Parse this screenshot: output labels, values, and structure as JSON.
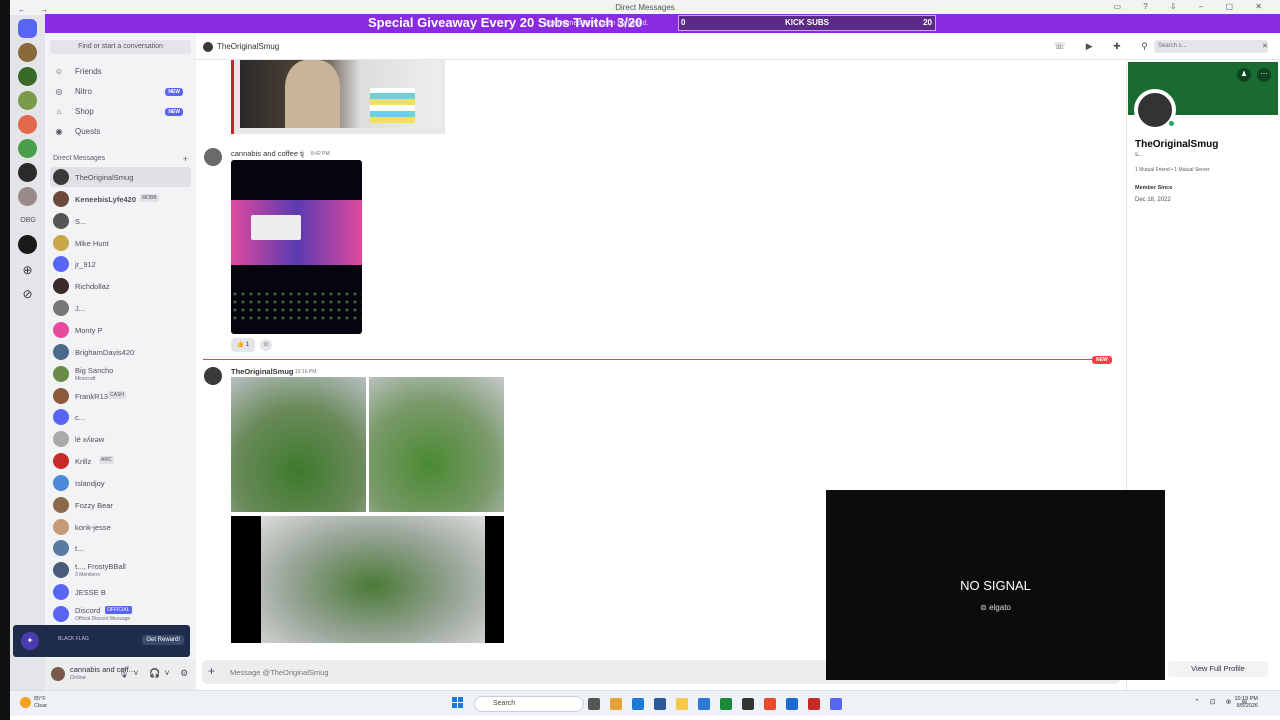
{
  "window": {
    "title": "Direct Messages",
    "nav": "← →",
    "controls": "▭ ? ⇩ – ▢ ✕"
  },
  "overlay": {
    "banner_text": "Special Giveaway Every 20 Subs Twitch 3/20",
    "count_left": "0",
    "kick_label": "KICK SUBS",
    "count_right": "20",
    "notice": "Usernames have been truncated."
  },
  "servers": {
    "obg_label": "OBG"
  },
  "sidebar": {
    "find_placeholder": "Find or start a conversation",
    "nav": [
      {
        "label": "Friends",
        "icon": "friends-icon",
        "new": ""
      },
      {
        "label": "Nitro",
        "icon": "nitro-icon",
        "new": "NEW"
      },
      {
        "label": "Shop",
        "icon": "shop-icon",
        "new": "NEW"
      },
      {
        "label": "Quests",
        "icon": "quests-icon",
        "new": ""
      }
    ],
    "dm_header": "Direct Messages",
    "dms": [
      {
        "name": "TheOriginalSmug",
        "sub": "",
        "tag": ""
      },
      {
        "name": "KeneebisLyfe420",
        "sub": "",
        "tag": "MOBB"
      },
      {
        "name": "S...",
        "sub": "",
        "tag": ""
      },
      {
        "name": "Mike Hunt",
        "sub": "",
        "tag": ""
      },
      {
        "name": "jr_912",
        "sub": "",
        "tag": ""
      },
      {
        "name": "Richdollaz",
        "sub": "",
        "tag": ""
      },
      {
        "name": "J...",
        "sub": "",
        "tag": ""
      },
      {
        "name": "Monty P",
        "sub": "",
        "tag": ""
      },
      {
        "name": "BrighamDavis420",
        "sub": "",
        "tag": ""
      },
      {
        "name": "Big Sancho",
        "sub": "Minecraft",
        "tag": ""
      },
      {
        "name": "FrankR13",
        "sub": "",
        "tag": "CASH"
      },
      {
        "name": "c...",
        "sub": "",
        "tag": ""
      },
      {
        "name": "lé xʎɐəw",
        "sub": "",
        "tag": ""
      },
      {
        "name": "Krillz",
        "sub": "",
        "tag": "ARC"
      },
      {
        "name": "Islandjoy",
        "sub": "",
        "tag": ""
      },
      {
        "name": "Fozzy Bear",
        "sub": "",
        "tag": ""
      },
      {
        "name": "konk-jesse",
        "sub": "",
        "tag": ""
      },
      {
        "name": "t...",
        "sub": "",
        "tag": ""
      },
      {
        "name": "t..., FrostyBBall",
        "sub": "3 Members",
        "tag": ""
      },
      {
        "name": "JESSE B",
        "sub": "",
        "tag": ""
      },
      {
        "name": "Discord",
        "sub": "Official Discord Message",
        "tag": "OFFICIAL"
      }
    ],
    "ad": {
      "logo": "BLACK FLAG",
      "button": "Get Reward!"
    },
    "user": {
      "name": "cannabis and coff...",
      "status": "Online"
    }
  },
  "chat": {
    "recipient": "TheOriginalSmug",
    "search_placeholder": "Search s...",
    "messages": [
      {
        "author": "cannabis and coffee tj",
        "time": "8:42 PM"
      },
      {
        "author": "TheOriginalSmug",
        "time": "10:16 PM"
      }
    ],
    "reaction": {
      "emoji": "👍",
      "count": "1"
    },
    "new_label": "NEW",
    "composer_placeholder": "Message @TheOriginalSmug"
  },
  "profile": {
    "display_name": "TheOriginalSmug",
    "handle": "s...",
    "mutuals": "1 Mutual Friend • 1 Mutual Server",
    "member_since_label": "Member Since",
    "member_since": "Dec 18, 2022",
    "view_full": "View Full Profile"
  },
  "capture": {
    "no_signal": "NO SIGNAL",
    "brand": "elgato"
  },
  "taskbar": {
    "temp": "85°F",
    "weather": "Clear",
    "search": "Search",
    "time": "10:19 PM",
    "date": "8/5/2026"
  }
}
